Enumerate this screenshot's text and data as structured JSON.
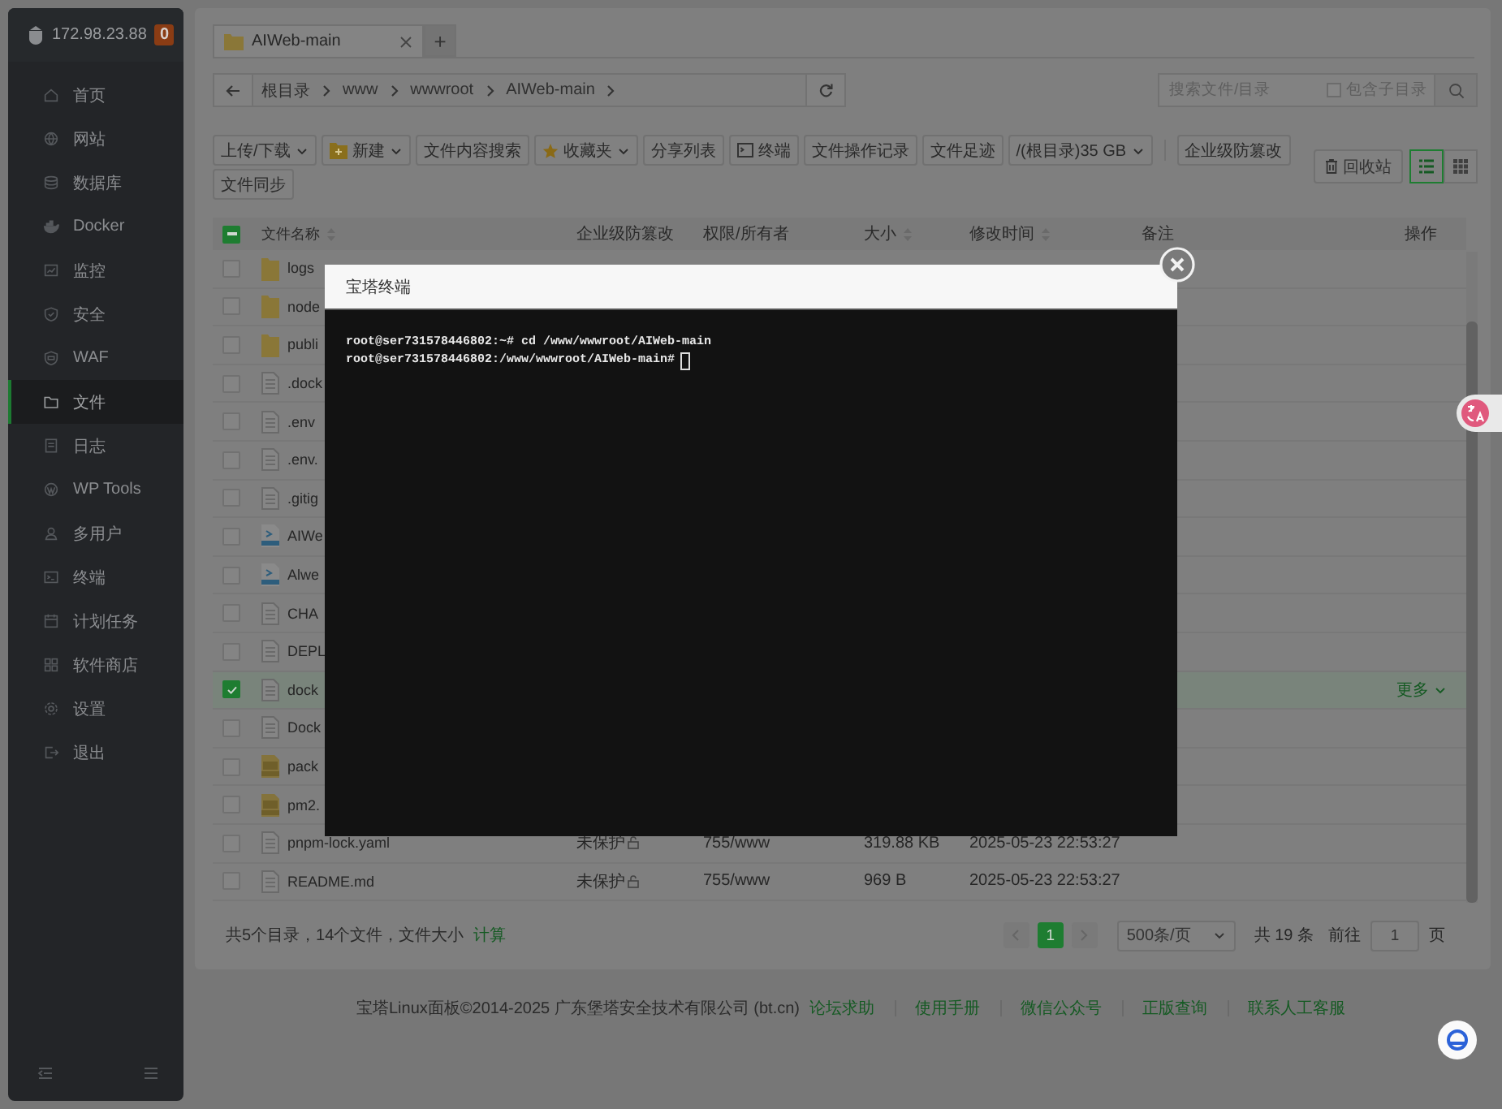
{
  "sidebar": {
    "server": "172.98.23.88",
    "badge": "0",
    "items": [
      {
        "label": "首页",
        "selected": false
      },
      {
        "label": "网站",
        "selected": false
      },
      {
        "label": "数据库",
        "selected": false
      },
      {
        "label": "Docker",
        "selected": false
      },
      {
        "label": "监控",
        "selected": false
      },
      {
        "label": "安全",
        "selected": false
      },
      {
        "label": "WAF",
        "selected": false
      },
      {
        "label": "文件",
        "selected": true
      },
      {
        "label": "日志",
        "selected": false
      },
      {
        "label": "WP Tools",
        "selected": false
      },
      {
        "label": "多用户",
        "selected": false
      },
      {
        "label": "终端",
        "selected": false
      },
      {
        "label": "计划任务",
        "selected": false
      },
      {
        "label": "软件商店",
        "selected": false
      },
      {
        "label": "设置",
        "selected": false
      },
      {
        "label": "退出",
        "selected": false
      }
    ]
  },
  "file_tabs": [
    {
      "label": "AIWeb-main",
      "selected": true
    }
  ],
  "new_tab_button": "+",
  "breadcrumb": [
    "根目录",
    "www",
    "wwwroot",
    "AIWeb-main"
  ],
  "search": {
    "placeholder": "搜索文件/目录",
    "subdir_label": "包含子目录",
    "subdir_checked": false
  },
  "toolbar": [
    {
      "label": "上传/下载",
      "kind": "dropdown"
    },
    {
      "label": "新建",
      "kind": "dropdown"
    },
    {
      "label": "文件内容搜索",
      "kind": "button"
    },
    {
      "label": "收藏夹",
      "kind": "dropdown"
    },
    {
      "label": "分享列表",
      "kind": "button"
    },
    {
      "label": "终端",
      "kind": "button"
    },
    {
      "label": "文件操作记录",
      "kind": "button"
    },
    {
      "label": "文件足迹",
      "kind": "button"
    },
    {
      "label": "/(根目录)35 GB",
      "kind": "dropdown"
    },
    {
      "kind": "divider"
    },
    {
      "label": "企业级防篡改",
      "kind": "button"
    },
    {
      "label": "文件同步",
      "kind": "button"
    }
  ],
  "recycle_bin": "回收站",
  "view_modes": [
    {
      "kind": "list",
      "selected": true
    },
    {
      "kind": "grid",
      "selected": false
    }
  ],
  "table": {
    "columns": [
      "文件名称",
      "企业级防篡改",
      "权限/所有者",
      "大小",
      "修改时间",
      "备注",
      "操作"
    ],
    "header_checkbox": {
      "indeterminate": true
    },
    "rows": [
      {
        "name": "logs",
        "kind": "folder",
        "selected": false
      },
      {
        "name": "node",
        "kind": "folder",
        "selected": false
      },
      {
        "name": "publi",
        "kind": "folder",
        "selected": false
      },
      {
        "name": ".dock",
        "kind": "file",
        "selected": false
      },
      {
        "name": ".env",
        "kind": "file",
        "selected": false
      },
      {
        "name": ".env.",
        "kind": "file",
        "selected": false
      },
      {
        "name": ".gitig",
        "kind": "file",
        "selected": false
      },
      {
        "name": "AIWe",
        "kind": "script",
        "selected": false
      },
      {
        "name": "Alwe",
        "kind": "script",
        "selected": false
      },
      {
        "name": "CHA",
        "kind": "file",
        "selected": false
      },
      {
        "name": "DEPL",
        "kind": "file",
        "selected": false
      },
      {
        "name": "dock",
        "kind": "file",
        "selected": true,
        "action": "更多"
      },
      {
        "name": "Dock",
        "kind": "file",
        "selected": false
      },
      {
        "name": "pack",
        "kind": "json",
        "selected": false
      },
      {
        "name": "pm2.",
        "kind": "json",
        "selected": false
      },
      {
        "name": "pnpm-lock.yaml",
        "kind": "file",
        "selected": false,
        "protection": "未保护",
        "permission": "755/www",
        "size": "319.88 KB",
        "modified": "2025-05-23 22:53:27"
      },
      {
        "name": "README.md",
        "kind": "file",
        "selected": false,
        "protection": "未保护",
        "permission": "755/www",
        "size": "969 B",
        "modified": "2025-05-23 22:53:27"
      }
    ]
  },
  "summary": {
    "text": "共5个目录，14个文件，文件大小",
    "link": "计算"
  },
  "pagination": {
    "pages": [
      {
        "label": "1",
        "selected": true
      }
    ],
    "page_size": "500条/页",
    "total": "共 19 条",
    "goto_label": "前往",
    "goto_value": "1",
    "page_suffix": "页"
  },
  "footer": {
    "copyright": "宝塔Linux面板©2014-2025 广东堡塔安全技术有限公司 (bt.cn)",
    "links": [
      "论坛求助",
      "使用手册",
      "微信公众号",
      "正版查询",
      "联系人工客服"
    ]
  },
  "terminal": {
    "title": "宝塔终端",
    "lines": [
      "root@ser731578446802:~# cd /www/wwwroot/AIWeb-main",
      "root@ser731578446802:/www/wwwroot/AIWeb-main#"
    ],
    "cursor": true
  }
}
